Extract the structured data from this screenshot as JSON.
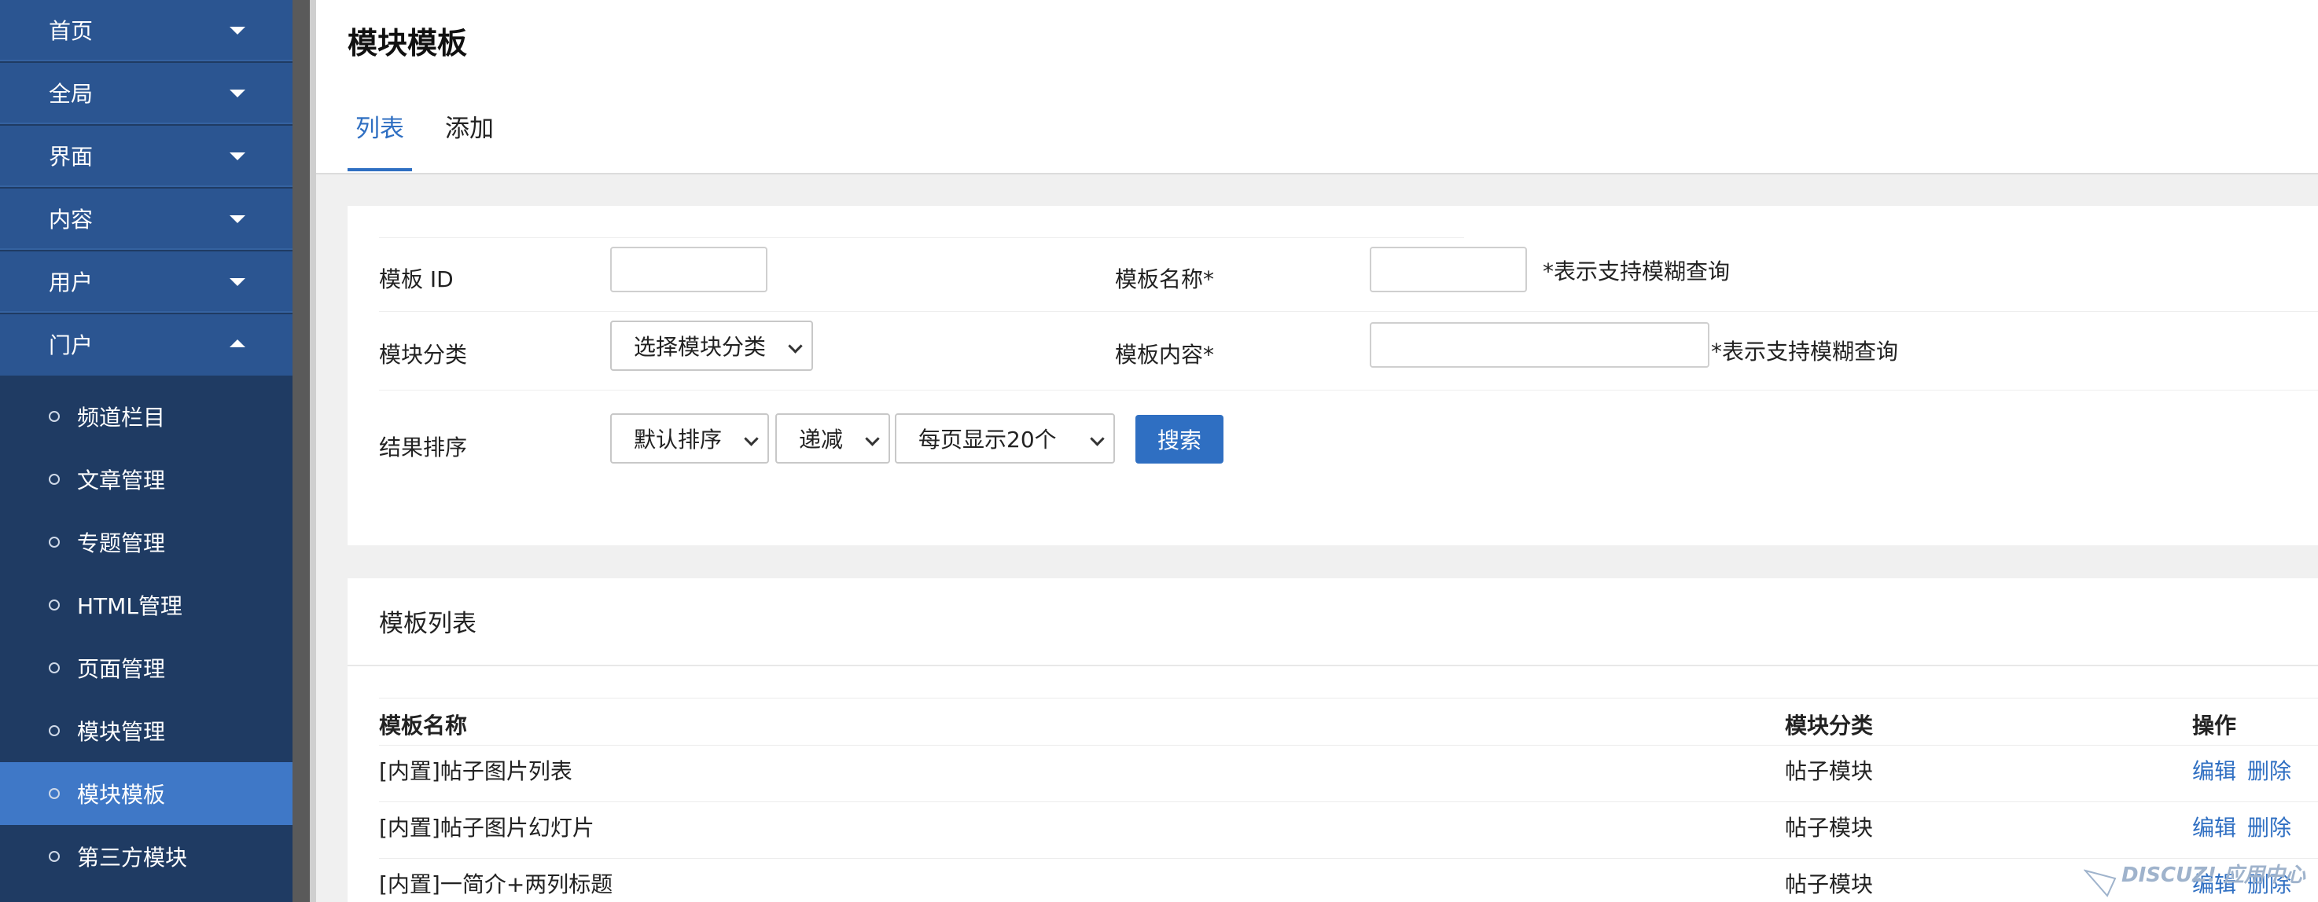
{
  "sidebar": {
    "menus": [
      {
        "label": "首页"
      },
      {
        "label": "全局"
      },
      {
        "label": "界面"
      },
      {
        "label": "内容"
      },
      {
        "label": "用户"
      },
      {
        "label": "门户"
      }
    ],
    "sub_items": [
      {
        "label": "频道栏目"
      },
      {
        "label": "文章管理"
      },
      {
        "label": "专题管理"
      },
      {
        "label": "HTML管理"
      },
      {
        "label": "页面管理"
      },
      {
        "label": "模块管理"
      },
      {
        "label": "模块模板"
      },
      {
        "label": "第三方模块"
      }
    ],
    "active_sub": "模块模板"
  },
  "header": {
    "title": "模块模板",
    "tabs": [
      {
        "label": "列表"
      },
      {
        "label": "添加"
      }
    ],
    "active_tab": "列表"
  },
  "search": {
    "template_id_label": "模板 ID",
    "template_id_value": "",
    "template_name_label": "模板名称*",
    "template_name_value": "",
    "fuzzy_hint_1": "*表示支持模糊查询",
    "category_label": "模块分类",
    "category_selected": "选择模块分类",
    "content_label": "模板内容*",
    "content_value": "",
    "fuzzy_hint_2": "*表示支持模糊查询",
    "sort_label": "结果排序",
    "sort_selected": "默认排序",
    "order_selected": "递减",
    "perpage_selected": "每页显示20个",
    "search_button": "搜索"
  },
  "list": {
    "title": "模板列表",
    "columns": [
      "模板名称",
      "模块分类",
      "操作"
    ],
    "rows": [
      {
        "name": "[内置]帖子图片列表",
        "category": "帖子模块",
        "edit": "编辑",
        "delete": "删除"
      },
      {
        "name": "[内置]帖子图片幻灯片",
        "category": "帖子模块",
        "edit": "编辑",
        "delete": "删除"
      },
      {
        "name": "[内置]一简介+两列标题",
        "category": "帖子模块",
        "edit": "编辑",
        "delete": "删除"
      }
    ]
  },
  "watermark": {
    "text": "DISCUZ! 应用中心"
  },
  "colors": {
    "sidebar_bg": "#1f3b63",
    "sidebar_menu": "#2b5591",
    "active_item": "#3f78c7",
    "accent": "#2f6fc2"
  }
}
